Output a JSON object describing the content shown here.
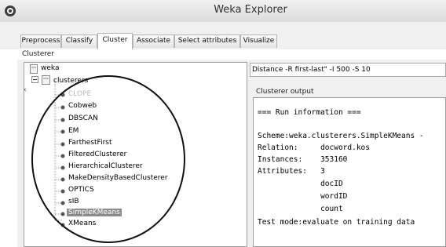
{
  "window": {
    "title": "Weka Explorer"
  },
  "tabs": [
    {
      "label": "Preprocess"
    },
    {
      "label": "Classify"
    },
    {
      "label": "Cluster",
      "active": true
    },
    {
      "label": "Associate"
    },
    {
      "label": "Select attributes"
    },
    {
      "label": "Visualize"
    }
  ],
  "clusterer": {
    "group_label": "Clusterer",
    "command": "Distance -R first-last\" -I 500 -S 10"
  },
  "tree": {
    "root": "weka",
    "folder": "clusterers",
    "items": [
      {
        "label": "CLOPE",
        "state": "muted"
      },
      {
        "label": "Cobweb"
      },
      {
        "label": "DBSCAN"
      },
      {
        "label": "EM"
      },
      {
        "label": "FarthestFirst"
      },
      {
        "label": "FilteredClusterer"
      },
      {
        "label": "HierarchicalClusterer"
      },
      {
        "label": "MakeDensityBasedClusterer"
      },
      {
        "label": "OPTICS"
      },
      {
        "label": "sIB"
      },
      {
        "label": "SimpleKMeans",
        "state": "selected"
      },
      {
        "label": "XMeans"
      }
    ]
  },
  "output": {
    "label": "Clusterer output",
    "lines": [
      "=== Run information ===",
      "",
      "Scheme:weka.clusterers.SimpleKMeans -",
      "Relation:     docword.kos",
      "Instances:    353160",
      "Attributes:   3",
      "              docID",
      "              wordID",
      "              count",
      "Test mode:evaluate on training data"
    ]
  },
  "colors": {
    "selection": "#8c8c8c",
    "annotation": "#111111"
  }
}
